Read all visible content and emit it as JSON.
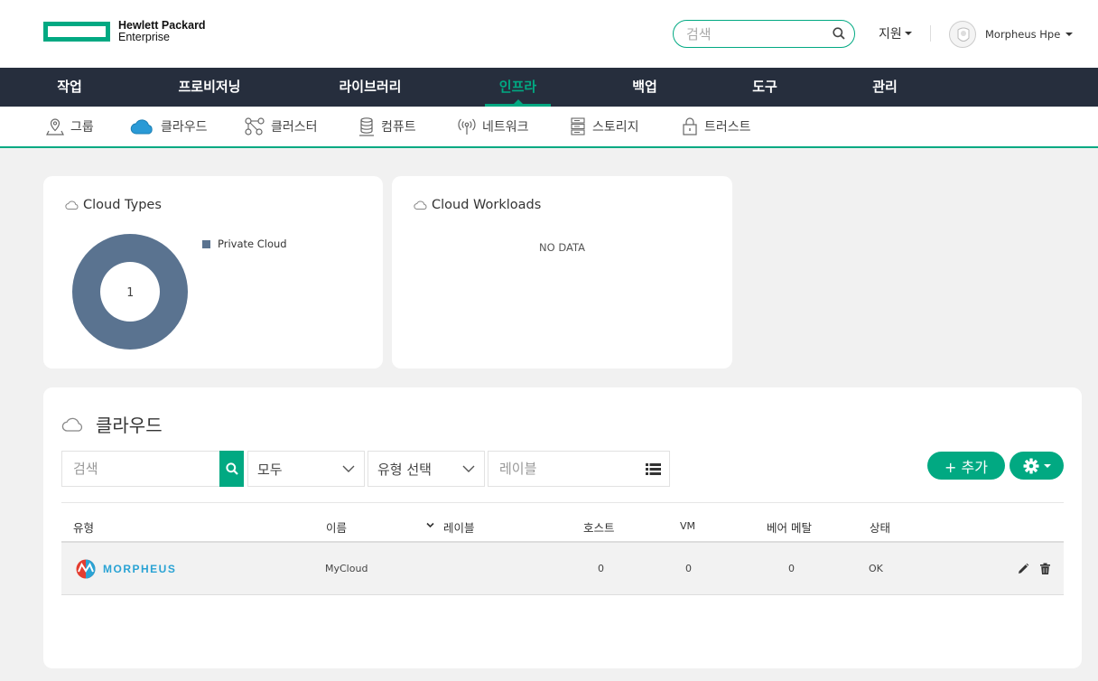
{
  "brand": {
    "line1": "Hewlett Packard",
    "line2": "Enterprise"
  },
  "header": {
    "search_placeholder": "검색",
    "support_label": "지원",
    "user_name": "Morpheus Hpe"
  },
  "main_nav": [
    {
      "label": "작업"
    },
    {
      "label": "프로비저닝"
    },
    {
      "label": "라이브러리"
    },
    {
      "label": "인프라",
      "active": true
    },
    {
      "label": "백업"
    },
    {
      "label": "도구"
    },
    {
      "label": "관리"
    }
  ],
  "sub_nav": [
    {
      "label": "그룹",
      "icon": "map-pin-icon"
    },
    {
      "label": "클라우드",
      "icon": "cloud-icon",
      "active": true
    },
    {
      "label": "클러스터",
      "icon": "cluster-icon"
    },
    {
      "label": "컴퓨트",
      "icon": "database-icon"
    },
    {
      "label": "네트워크",
      "icon": "antenna-icon"
    },
    {
      "label": "스토리지",
      "icon": "server-icon"
    },
    {
      "label": "트러스트",
      "icon": "lock-icon"
    }
  ],
  "cards": {
    "cloud_types": {
      "title": "Cloud Types",
      "chart_data": {
        "type": "pie",
        "title": "",
        "categories": [
          "Private Cloud"
        ],
        "values": [
          1
        ],
        "center_label": "1",
        "legend": "right",
        "colors": [
          "#5a7390"
        ]
      }
    },
    "cloud_workloads": {
      "title": "Cloud Workloads",
      "empty_text": "NO DATA"
    }
  },
  "clouds_panel": {
    "title": "클라우드",
    "filters": {
      "search_placeholder": "검색",
      "scope_value": "모두",
      "type_value": "유형 선택",
      "label_placeholder": "레이블"
    },
    "add_label": "+ 추가",
    "columns": [
      "유형",
      "이름",
      "레이블",
      "호스트",
      "VM",
      "베어 메탈",
      "상태"
    ],
    "rows": [
      {
        "type_logo": "MORPHEUS",
        "name": "MyCloud",
        "labels": "",
        "hosts": "0",
        "vms": "0",
        "bare_metal": "0",
        "status": "OK"
      }
    ]
  },
  "colors": {
    "accent": "#01a982",
    "nav_bg": "#262e3d",
    "chart": "#5a7390"
  }
}
